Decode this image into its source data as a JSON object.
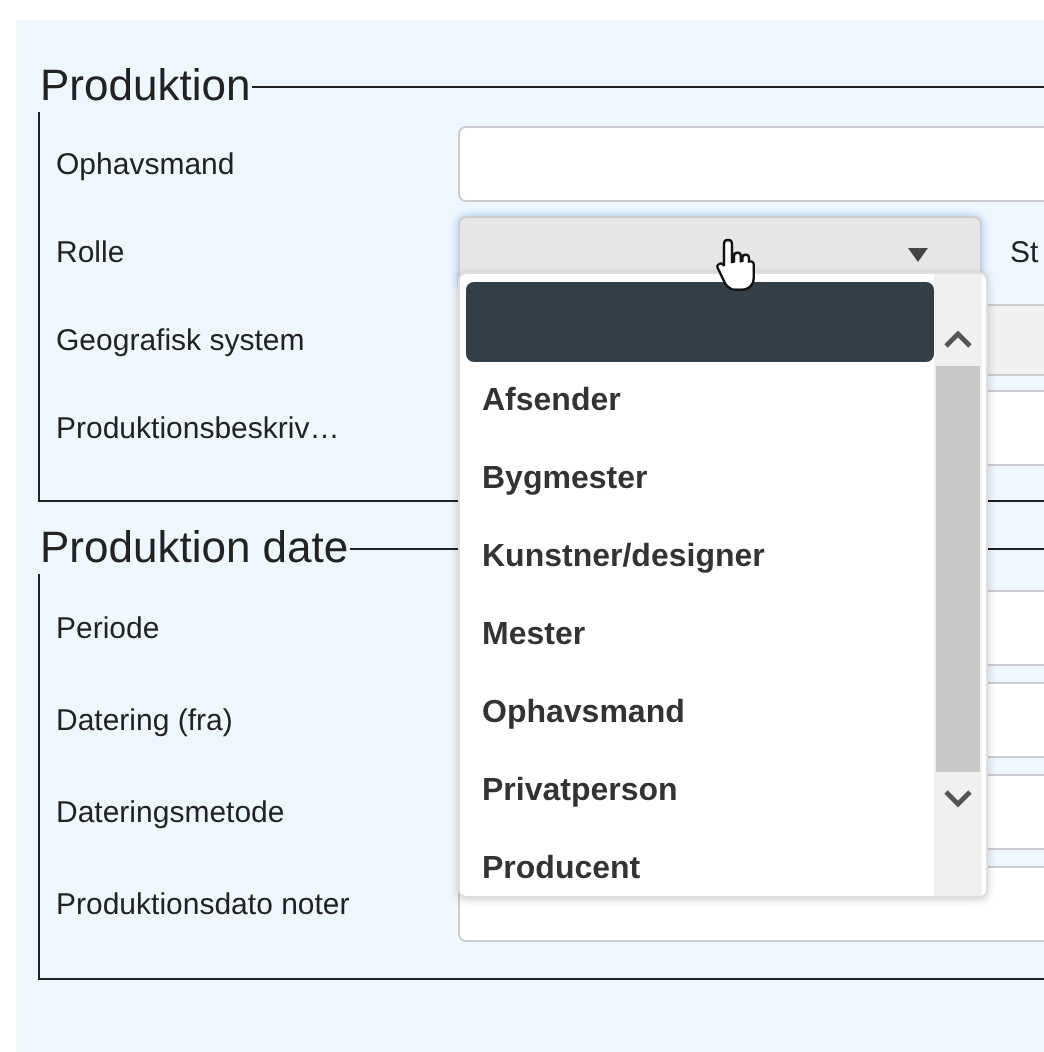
{
  "sections": [
    {
      "legend": "Produktion",
      "rows": [
        {
          "label": "Ophavsmand",
          "kind": "text"
        },
        {
          "label": "Rolle",
          "kind": "select",
          "side_label": "St",
          "open": true
        },
        {
          "label": "Geografisk system",
          "kind": "select"
        },
        {
          "label": "Produktionsbeskriv…",
          "kind": "text"
        }
      ]
    },
    {
      "legend": "Produktion date",
      "rows": [
        {
          "label": "Periode",
          "kind": "text"
        },
        {
          "label": "Datering (fra)",
          "kind": "text"
        },
        {
          "label": "Dateringsmetode",
          "kind": "text"
        },
        {
          "label": "Produktionsdato noter",
          "kind": "text"
        }
      ]
    }
  ],
  "dropdown": {
    "blank_option_highlighted": true,
    "options": [
      {
        "label": "Afsender",
        "selected": false
      },
      {
        "label": "Bygmester",
        "selected": false
      },
      {
        "label": "Kunstner/designer",
        "selected": false
      },
      {
        "label": "Mester",
        "selected": false
      },
      {
        "label": "Ophavsmand",
        "selected": false
      },
      {
        "label": "Privatperson",
        "selected": false
      },
      {
        "label": "Producent",
        "selected": false
      }
    ]
  }
}
